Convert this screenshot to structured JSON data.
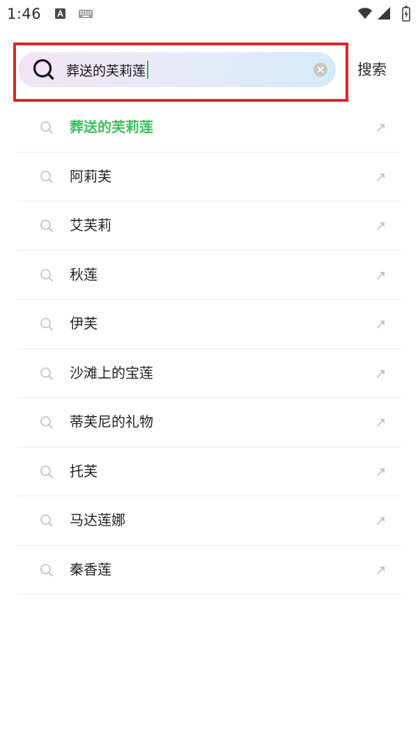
{
  "status_bar": {
    "time": "1:46",
    "icons": {
      "left": [
        "app-notification-icon",
        "keyboard-icon"
      ],
      "right": [
        "wifi-icon",
        "cellular-signal-icon",
        "battery-charging-icon"
      ]
    }
  },
  "search": {
    "query": "葬送的芙莉莲",
    "submit_label": "搜索",
    "icons": {
      "search": "search-icon",
      "clear": "clear-icon"
    }
  },
  "suggestions": [
    {
      "text": "葬送的芙莉莲",
      "highlighted": true
    },
    {
      "text": "阿莉芙"
    },
    {
      "text": "艾芙莉"
    },
    {
      "text": "秋莲"
    },
    {
      "text": "伊芙"
    },
    {
      "text": "沙滩上的宝莲"
    },
    {
      "text": "蒂芙尼的礼物"
    },
    {
      "text": "托芙"
    },
    {
      "text": "马达莲娜"
    },
    {
      "text": "秦香莲"
    }
  ],
  "suggestion_icons": {
    "leading": "search-icon",
    "trailing": "arrow-up-right-icon"
  },
  "colors": {
    "highlight_outline": "#e1232b",
    "match_text": "#3dbf5e",
    "cursor": "#2fb552",
    "input_gradient_start": "#f2e3f4",
    "input_gradient_mid": "#e7e9f7",
    "input_gradient_end": "#d6ebf8"
  }
}
